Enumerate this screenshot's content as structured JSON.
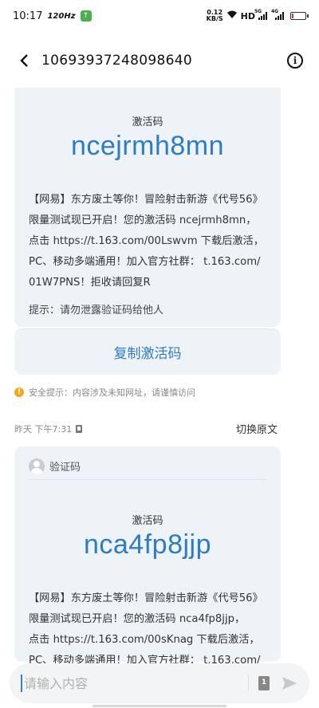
{
  "status": {
    "time": "10:17",
    "speed": "120Hz",
    "net_speed_value": "0.12",
    "net_speed_unit": "KB/S",
    "hd": "HD",
    "sim1_label": "5G",
    "sim2_label": "4G",
    "battery_level": 0.12
  },
  "header": {
    "back_icon": "chevron-left-icon",
    "title": "10693937248098640",
    "info_icon": "info-icon"
  },
  "message1": {
    "code_label": "激活码",
    "code": "ncejrmh8mn",
    "lines": [
      "【网易】东方废土等你！冒险射击新游《代号56》",
      "限量测试现已开启！您的激活码 ncejrmh8mn，",
      "点击 https://t.163.com/00Lswvm 下载后激活，",
      "PC、移动多端通用！加入官方社群： t.163.com/",
      "01W7PNS！拒收请回复R"
    ],
    "hint": "提示：请勿泄露验证码给他人",
    "copy_button": "复制激活码"
  },
  "security_notice": "安全提示：内容涉及未知网址，请谨慎访问",
  "timeline": {
    "time": "昨天 下午7:31",
    "toggle": "切换原文"
  },
  "message2": {
    "sender": "验证码",
    "code_label": "激活码",
    "code": "nca4fp8jjp",
    "lines": [
      "【网易】东方废土等你！冒险射击新游《代号56》",
      "限量测试现已开启！您的激活码 nca4fp8jjp，",
      "点击 https://t.163.com/00sKnag 下载后激活，",
      "PC、移动多端通用！加入官方社群： t.163.com/"
    ]
  },
  "composer": {
    "placeholder": "请输入内容",
    "sim_label": "1"
  },
  "colors": {
    "accent": "#2e7cc2",
    "card_bg": "#eef3f8",
    "warning": "#f5a623"
  }
}
